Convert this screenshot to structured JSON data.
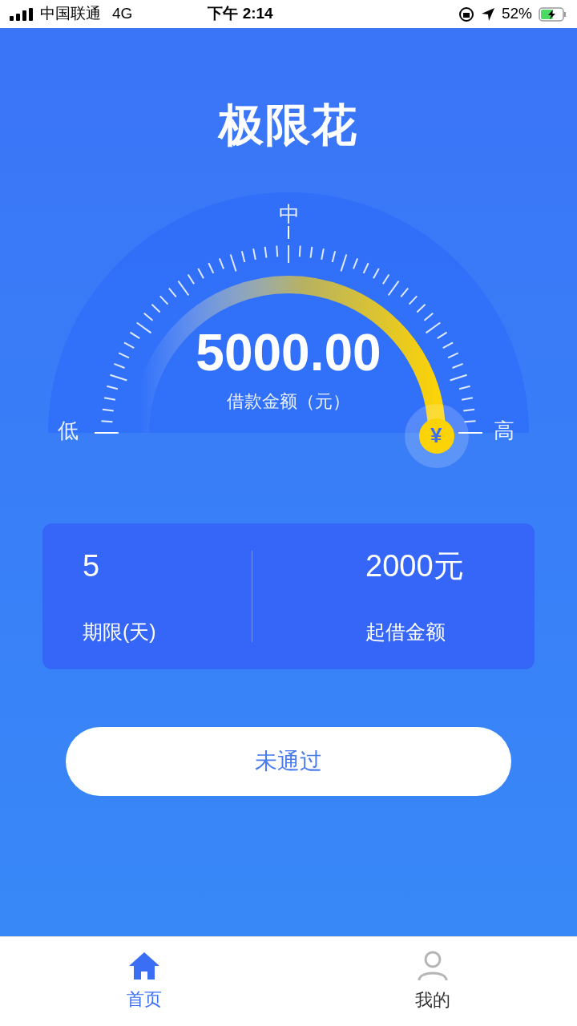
{
  "status_bar": {
    "carrier": "中国联通",
    "network": "4G",
    "time": "下午 2:14",
    "battery": "52%"
  },
  "title": "极限花",
  "gauge": {
    "mid_label": "中",
    "low_label": "低",
    "high_label": "高",
    "amount": "5000.00",
    "amount_label": "借款金额（元）",
    "knob_symbol": "¥"
  },
  "info_card": {
    "items": [
      {
        "value": "5",
        "label": "期限(天)"
      },
      {
        "value": "2000元",
        "label": "起借金额"
      }
    ]
  },
  "action_button": {
    "label": "未通过",
    "disabled": true
  },
  "tab_bar": [
    {
      "label": "首页",
      "selected": true,
      "kind": "home"
    },
    {
      "label": "我的",
      "selected": false,
      "kind": "person"
    }
  ]
}
